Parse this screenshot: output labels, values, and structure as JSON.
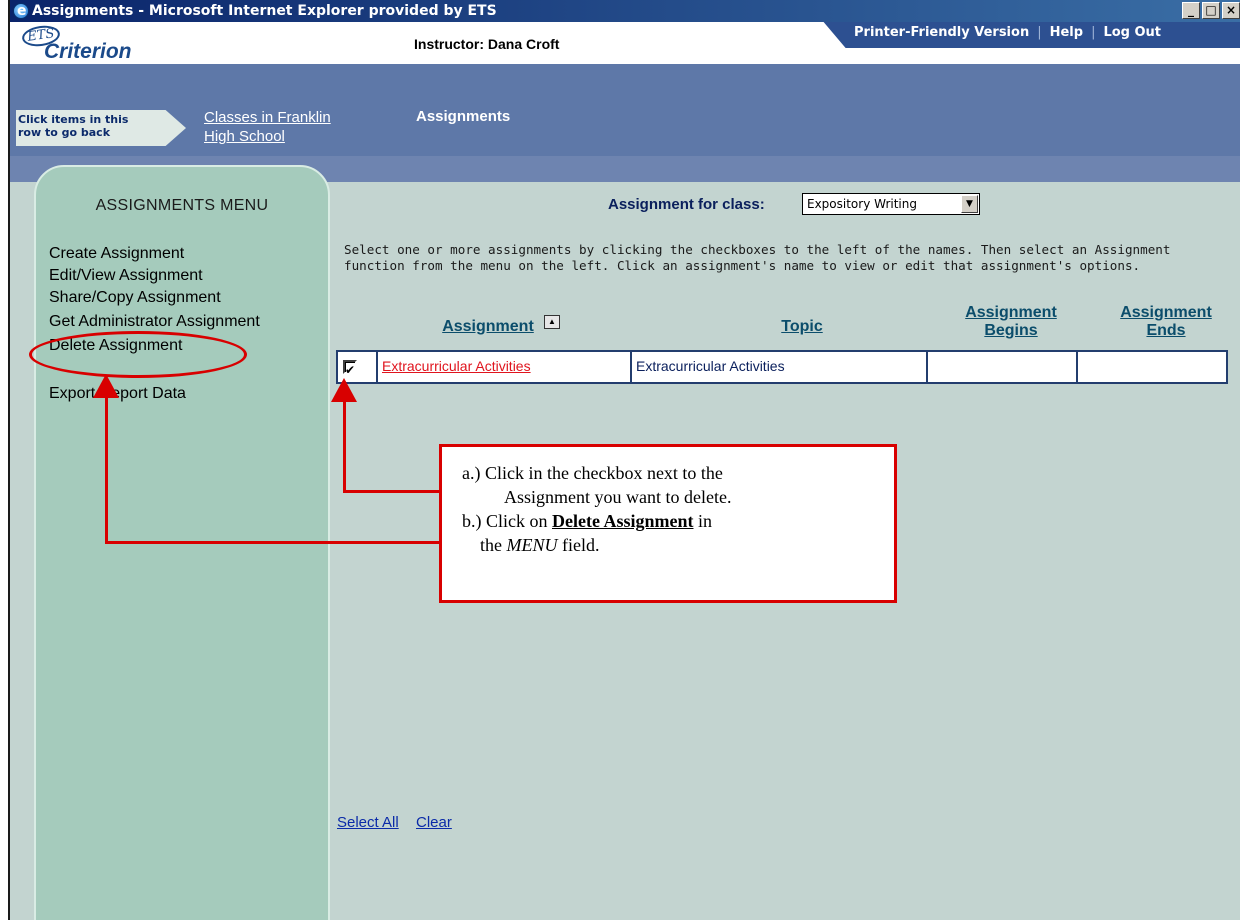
{
  "window": {
    "title": "Assignments - Microsoft Internet Explorer provided by ETS",
    "buttons": {
      "minimize": "_",
      "maximize": "□",
      "close": "×"
    }
  },
  "header": {
    "logo_ets": "ETS",
    "logo_name": "Criterion",
    "instructor": "Instructor: Dana Croft",
    "links": {
      "printer": "Printer-Friendly Version",
      "help": "Help",
      "logout": "Log Out",
      "separator": "|"
    }
  },
  "nav": {
    "back_hint_line1": "Click items in this",
    "back_hint_line2": "row to go back",
    "crumb_line1": "Classes in Franklin",
    "crumb_line2": "High School",
    "current": "Assignments"
  },
  "sidebar": {
    "title": "ASSIGNMENTS MENU",
    "items": [
      {
        "label": "Create Assignment"
      },
      {
        "label": "Edit/View Assignment"
      },
      {
        "label": "Share/Copy Assignment"
      },
      {
        "label": "Get Administrator Assignment"
      },
      {
        "label": "Delete Assignment"
      },
      {
        "label": "Export Report Data"
      }
    ]
  },
  "main": {
    "class_label": "Assignment for class:",
    "class_selected": "Expository Writing",
    "instructions": "Select one or more assignments by clicking the checkboxes to the left of the names. Then select an Assignment function from the menu on the left. Click an assignment's name to view or edit that assignment's options.",
    "columns": {
      "assignment": "Assignment",
      "topic": "Topic",
      "begins_line1": "Assignment",
      "begins_line2": "Begins",
      "ends_line1": "Assignment",
      "ends_line2": "Ends"
    },
    "rows": [
      {
        "checked": true,
        "assignment": "Extracurricular Activities",
        "topic": "Extracurricular Activities",
        "begins": "",
        "ends": ""
      }
    ],
    "select_all": "Select All",
    "clear": "Clear"
  },
  "callout": {
    "line1": "a.)  Click in the checkbox next to the",
    "line2": "Assignment you want to delete.",
    "line3_prefix": "b.)  Click on ",
    "line3_bold": "Delete Assignment",
    "line3_suffix": " in",
    "line4_prefix": "the ",
    "line4_italic": "MENU",
    "line4_suffix": " field."
  },
  "colors": {
    "annotation_red": "#d80000",
    "sidebar_green": "#a5cbbc",
    "content_bg": "#c3d4d0",
    "nav_blue": "#5e78a8",
    "link_red": "#e0141e"
  }
}
